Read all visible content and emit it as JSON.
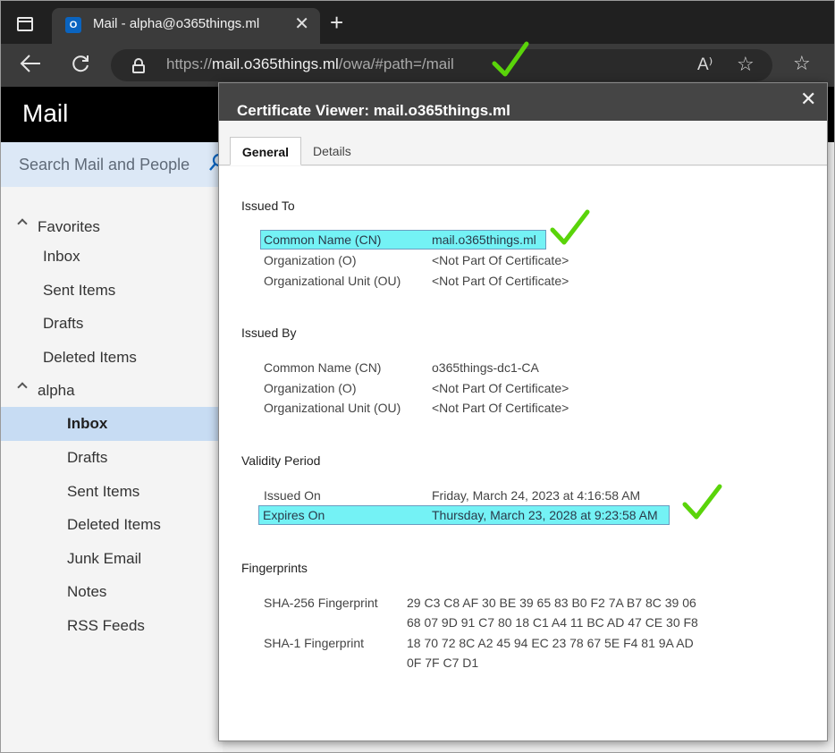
{
  "browser": {
    "tab_title": "Mail - alpha@o365things.ml",
    "favicon_letter": "O",
    "tab_close": "✕",
    "new_tab": "+",
    "url_scheme": "https://",
    "url_host": "mail.o365things.ml",
    "url_path": "/owa/#path=/mail",
    "read_aloud": "A⁾",
    "add_favorite": "☆",
    "favorites": "☆"
  },
  "owa": {
    "app_title": "Mail",
    "search_placeholder": "Search Mail and People",
    "nav": [
      {
        "label": "Favorites",
        "type": "group"
      },
      {
        "label": "Inbox",
        "type": "fav"
      },
      {
        "label": "Sent Items",
        "type": "fav"
      },
      {
        "label": "Drafts",
        "type": "fav"
      },
      {
        "label": "Deleted Items",
        "type": "fav"
      },
      {
        "label": "alpha",
        "type": "group"
      },
      {
        "label": "Inbox",
        "type": "folder",
        "selected": true
      },
      {
        "label": "Drafts",
        "type": "folder"
      },
      {
        "label": "Sent Items",
        "type": "folder"
      },
      {
        "label": "Deleted Items",
        "type": "folder"
      },
      {
        "label": "Junk Email",
        "type": "folder"
      },
      {
        "label": "Notes",
        "type": "folder"
      },
      {
        "label": "RSS Feeds",
        "type": "folder"
      }
    ]
  },
  "dialog": {
    "title": "Certificate Viewer: mail.o365things.ml",
    "close": "✕",
    "tabs": [
      "General",
      "Details"
    ],
    "issued_to": {
      "heading": "Issued To",
      "rows": [
        {
          "key": "Common Name (CN)",
          "value": "mail.o365things.ml"
        },
        {
          "key": "Organization (O)",
          "value": "<Not Part Of Certificate>"
        },
        {
          "key": "Organizational Unit (OU)",
          "value": "<Not Part Of Certificate>"
        }
      ]
    },
    "issued_by": {
      "heading": "Issued By",
      "rows": [
        {
          "key": "Common Name (CN)",
          "value": "o365things-dc1-CA"
        },
        {
          "key": "Organization (O)",
          "value": "<Not Part Of Certificate>"
        },
        {
          "key": "Organizational Unit (OU)",
          "value": "<Not Part Of Certificate>"
        }
      ]
    },
    "validity": {
      "heading": "Validity Period",
      "rows": [
        {
          "key": "Issued On",
          "value": "Friday, March 24, 2023 at 4:16:58 AM"
        },
        {
          "key": "Expires On",
          "value": "Thursday, March 23, 2028 at 9:23:58 AM"
        }
      ]
    },
    "fingerprints": {
      "heading": "Fingerprints",
      "sha256_label": "SHA-256 Fingerprint",
      "sha256_line1": "29 C3 C8 AF 30 BE 39 65 83 B0 F2 7A B7 8C 39 06",
      "sha256_line2": "68 07 9D 91 C7 80 18 C1 A4 11 BC AD 47 CE 30 F8",
      "sha1_label": "SHA-1 Fingerprint",
      "sha1_line1": "18 70 72 8C A2 45 94 EC 23 78 67 5E F4 81 9A AD",
      "sha1_line2": "0F 7F C7 D1"
    }
  },
  "colors": {
    "highlight": "#74f2f5",
    "check": "#5ad40a",
    "owa_selected": "#c7dcf3"
  }
}
